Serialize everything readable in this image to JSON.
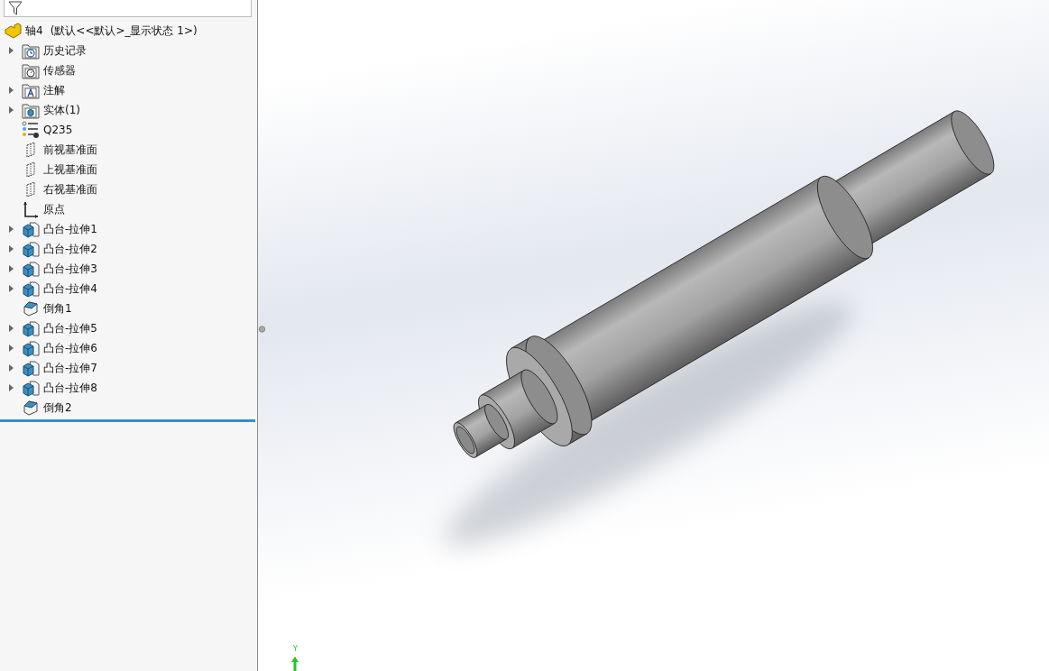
{
  "tree": {
    "root": {
      "label": "轴4",
      "config": "(默认<<默认>_显示状态 1>)"
    },
    "items": [
      {
        "label": "历史记录",
        "kind": "history",
        "expandable": true
      },
      {
        "label": "传感器",
        "kind": "sensor",
        "expandable": false
      },
      {
        "label": "注解",
        "kind": "annotation",
        "expandable": true
      },
      {
        "label": "实体(1)",
        "kind": "solid",
        "expandable": true
      },
      {
        "label": "Q235",
        "kind": "material",
        "expandable": false
      },
      {
        "label": "前视基准面",
        "kind": "plane",
        "expandable": false
      },
      {
        "label": "上视基准面",
        "kind": "plane",
        "expandable": false
      },
      {
        "label": "右视基准面",
        "kind": "plane",
        "expandable": false
      },
      {
        "label": "原点",
        "kind": "origin",
        "expandable": false
      },
      {
        "label": "凸台-拉伸1",
        "kind": "extrude",
        "expandable": true
      },
      {
        "label": "凸台-拉伸2",
        "kind": "extrude",
        "expandable": true
      },
      {
        "label": "凸台-拉伸3",
        "kind": "extrude",
        "expandable": true
      },
      {
        "label": "凸台-拉伸4",
        "kind": "extrude",
        "expandable": true
      },
      {
        "label": "倒角1",
        "kind": "chamfer",
        "expandable": false
      },
      {
        "label": "凸台-拉伸5",
        "kind": "extrude",
        "expandable": true
      },
      {
        "label": "凸台-拉伸6",
        "kind": "extrude",
        "expandable": true
      },
      {
        "label": "凸台-拉伸7",
        "kind": "extrude",
        "expandable": true
      },
      {
        "label": "凸台-拉伸8",
        "kind": "extrude",
        "expandable": true
      },
      {
        "label": "倒角2",
        "kind": "chamfer",
        "expandable": false
      }
    ]
  },
  "viewport": {
    "triad_label": "Y"
  }
}
